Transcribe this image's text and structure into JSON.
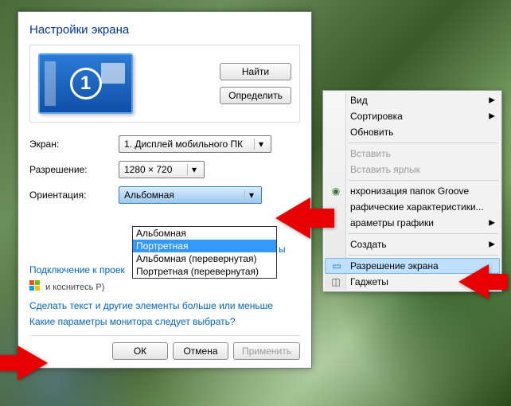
{
  "dialog": {
    "title": "Настройки экрана",
    "monitor_number": "1",
    "find_btn": "Найти",
    "identify_btn": "Определить",
    "screen_label": "Экран:",
    "screen_value": "1. Дисплей мобильного ПК",
    "resolution_label": "Разрешение:",
    "resolution_value": "1280 × 720",
    "orientation_label": "Ориентация:",
    "orientation_value": "Альбомная",
    "orientation_options": {
      "opt0": "Альбомная",
      "opt1": "Портретная",
      "opt2": "Альбомная (перевернутая)",
      "opt3": "Портретная (перевернутая)"
    },
    "projector_link": "Подключение к проек",
    "projector_hint": "и коснитесь P)",
    "textsize_link": "Сделать текст и другие элементы больше или меньше",
    "whichparams_link": "Какие параметры монитора следует выбрать?",
    "ok_btn": "ОК",
    "cancel_btn": "Отмена",
    "apply_btn": "Применить",
    "truncated_char": "ы"
  },
  "ctx": {
    "view": "Вид",
    "sort": "Сортировка",
    "refresh": "Обновить",
    "paste": "Вставить",
    "paste_shortcut": "Вставить ярлык",
    "groove": "нхронизация папок Groove",
    "gfx_chars": "рафические характеристики...",
    "gfx_params": "араметры графики",
    "create": "Создать",
    "resolution": "Разрешение экрана",
    "gadgets": "Гаджеты"
  }
}
